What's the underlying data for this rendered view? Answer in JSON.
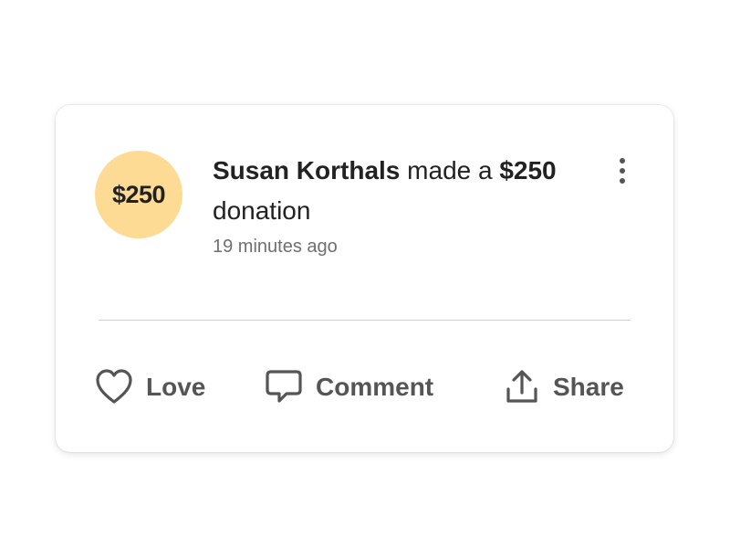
{
  "donation": {
    "avatar_text": "$250",
    "donor_name": "Susan Korthals",
    "action_text": " made a ",
    "amount": "$250",
    "suffix_text": " donation",
    "timestamp": "19 minutes ago"
  },
  "actions": {
    "love_label": "Love",
    "comment_label": "Comment",
    "share_label": "Share"
  },
  "icons": {
    "more": "more-vertical-icon",
    "love": "heart-icon",
    "comment": "speech-bubble-icon",
    "share": "share-upload-icon"
  },
  "colors": {
    "avatar_background": "#fddb94",
    "text_primary": "#222222",
    "text_secondary": "#6f6f6f",
    "action_text": "#555555",
    "divider": "#cfcfcf"
  }
}
